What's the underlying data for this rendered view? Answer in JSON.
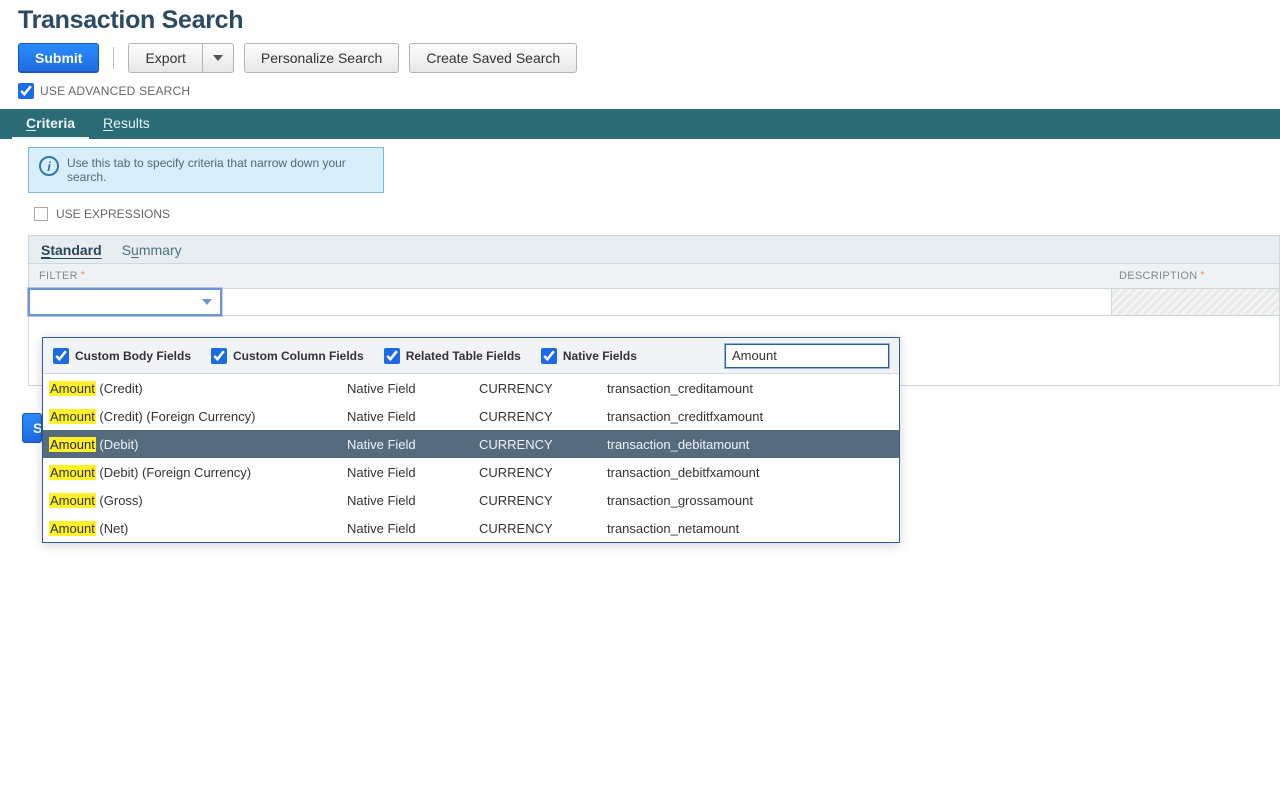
{
  "title": "Transaction Search",
  "buttons": {
    "submit": "Submit",
    "export": "Export",
    "personalize": "Personalize Search",
    "create_saved": "Create Saved Search"
  },
  "use_advanced": {
    "label": "USE ADVANCED SEARCH",
    "checked": true
  },
  "tabs": {
    "criteria": {
      "hot": "C",
      "rest": "riteria"
    },
    "results": {
      "hot": "R",
      "rest": "esults"
    }
  },
  "hint": "Use this tab to specify criteria that narrow down your search.",
  "use_expressions_label": "USE EXPRESSIONS",
  "subtabs": {
    "standard": {
      "hot": "S",
      "rest": "tandard"
    },
    "summary": {
      "pre": "S",
      "hot": "u",
      "rest": "mmary"
    }
  },
  "headers": {
    "filter": "FILTER",
    "description": "DESCRIPTION"
  },
  "dropdown": {
    "checkboxes": {
      "custom_body": "Custom Body Fields",
      "custom_col": "Custom Column Fields",
      "related": "Related Table Fields",
      "native": "Native Fields"
    },
    "search_value": "Amount",
    "hl_term": "Amount",
    "rows": [
      {
        "rest": " (Credit)",
        "type": "Native Field",
        "data": "CURRENCY",
        "id": "transaction_creditamount",
        "sel": false
      },
      {
        "rest": " (Credit) (Foreign Currency)",
        "type": "Native Field",
        "data": "CURRENCY",
        "id": "transaction_creditfxamount",
        "sel": false
      },
      {
        "rest": " (Debit)",
        "type": "Native Field",
        "data": "CURRENCY",
        "id": "transaction_debitamount",
        "sel": true
      },
      {
        "rest": " (Debit) (Foreign Currency)",
        "type": "Native Field",
        "data": "CURRENCY",
        "id": "transaction_debitfxamount",
        "sel": false
      },
      {
        "rest": " (Gross)",
        "type": "Native Field",
        "data": "CURRENCY",
        "id": "transaction_grossamount",
        "sel": false
      },
      {
        "rest": " (Net)",
        "type": "Native Field",
        "data": "CURRENCY",
        "id": "transaction_netamount",
        "sel": false
      }
    ]
  },
  "partial_submit_letter": "S"
}
